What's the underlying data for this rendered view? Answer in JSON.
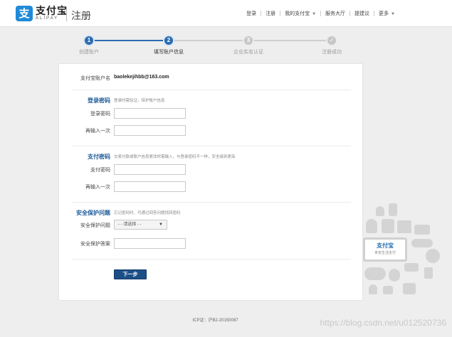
{
  "header": {
    "logo_glyph": "支",
    "brand_cn": "支付宝",
    "brand_en": "ALIPAY",
    "page_title": "注册",
    "nav": [
      {
        "label": "登录"
      },
      {
        "label": "注册"
      },
      {
        "label": "我的支付宝"
      },
      {
        "label": "服务大厅"
      },
      {
        "label": "提建议"
      },
      {
        "label": "更多"
      }
    ]
  },
  "steps": [
    {
      "num": "1",
      "label": "创建账户",
      "state": "done"
    },
    {
      "num": "2",
      "label": "填写账户信息",
      "state": "current"
    },
    {
      "num": "3",
      "label": "企业实名认证",
      "state": "todo"
    },
    {
      "num": "✓",
      "label": "注册成功",
      "state": "todo"
    }
  ],
  "form": {
    "account_label": "支付宝账户名",
    "account_value": "baolekejihbb@163.com",
    "login_section": {
      "title": "登录密码",
      "hint": "登录时需验证，保护账户信息",
      "password_label": "登录密码",
      "password_value": "",
      "confirm_label": "再输入一次",
      "confirm_value": ""
    },
    "pay_section": {
      "title": "支付密码",
      "hint": "交易付款或账户信息更改时需输入，与登录密码不一样，安全级别更高",
      "password_label": "支付密码",
      "password_value": "",
      "confirm_label": "再输入一次",
      "confirm_value": ""
    },
    "security_section": {
      "title": "安全保护问题",
      "hint": "忘记密码时，可通过回答问题找回密码",
      "question_label": "安全保护问题",
      "question_selected": "- - 请选择 - -",
      "answer_label": "安全保护答案",
      "answer_value": ""
    },
    "next_label": "下一步"
  },
  "illustration": {
    "brand": "支付宝",
    "tagline": "世安生活支付"
  },
  "footer": {
    "icp": "ICP证：沪B2-20150087"
  },
  "watermark": "https://blog.csdn.net/u012520736",
  "colors": {
    "primary_blue": "#2b6cb0",
    "button_blue": "#1c4f88",
    "section_title": "#1d5a99",
    "step_pending": "#c7c7c7"
  }
}
